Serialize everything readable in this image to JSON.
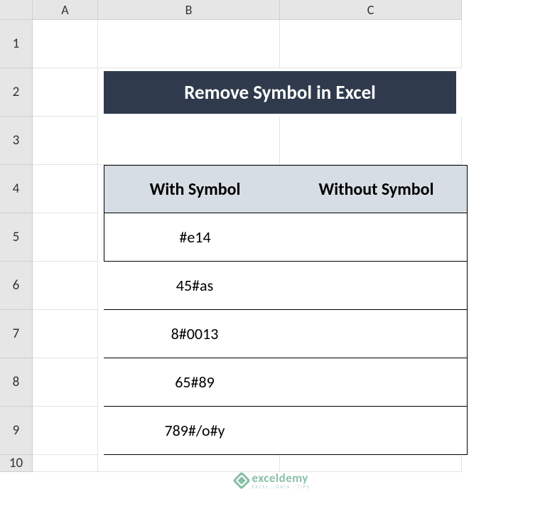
{
  "columns": [
    "A",
    "B",
    "C"
  ],
  "rows": [
    "1",
    "2",
    "3",
    "4",
    "5",
    "6",
    "7",
    "8",
    "9",
    "10"
  ],
  "title": "Remove Symbol in Excel",
  "table": {
    "headers": [
      "With Symbol",
      "Without Symbol"
    ],
    "data": [
      {
        "with": "#e14",
        "without": ""
      },
      {
        "with": "45#as",
        "without": ""
      },
      {
        "with": "8#0013",
        "without": ""
      },
      {
        "with": "65#89",
        "without": ""
      },
      {
        "with": "789#/o#y",
        "without": ""
      }
    ]
  },
  "watermark": {
    "main": "exceldemy",
    "sub": "EXCEL · DATA · TIPS"
  }
}
